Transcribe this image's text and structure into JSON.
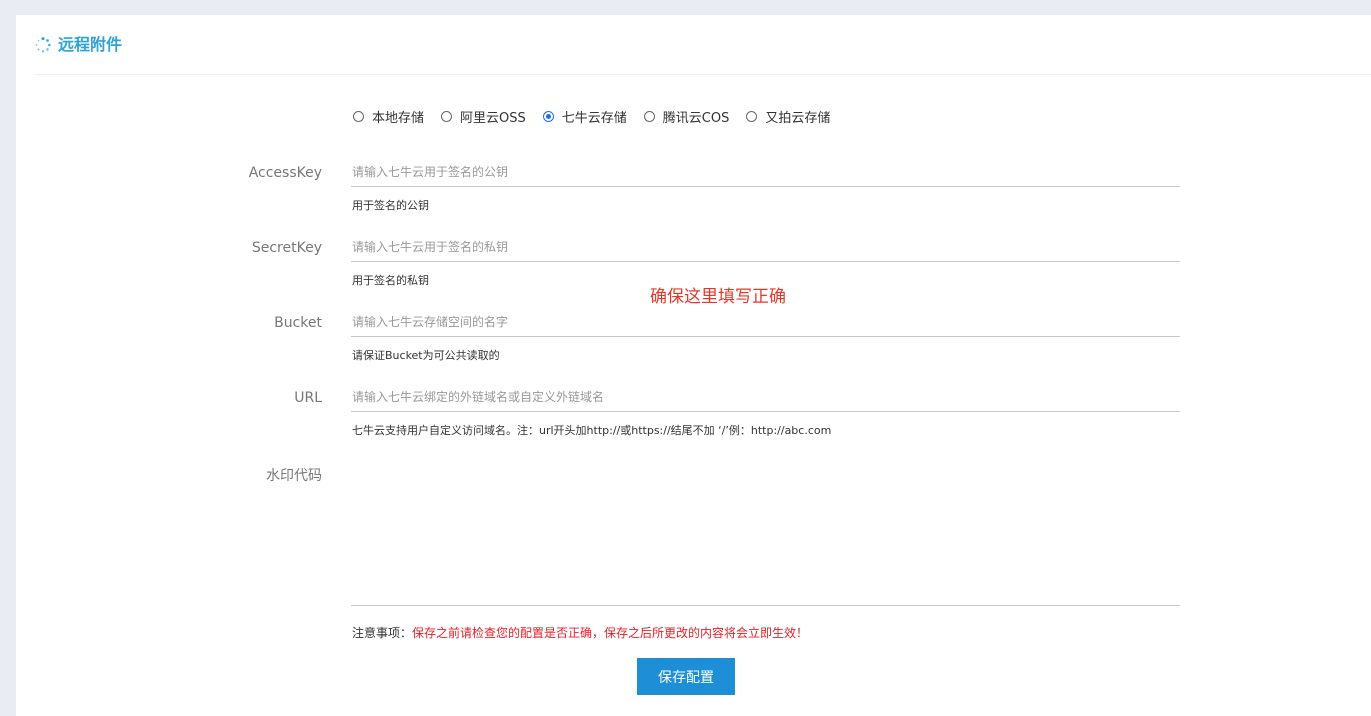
{
  "panel": {
    "title": "远程附件",
    "title_icon": "loading-spinner-icon",
    "accent_color": "#2fa4d4"
  },
  "storage_options": {
    "selected": "七牛云存储",
    "items": [
      {
        "label": "本地存储",
        "checked": false
      },
      {
        "label": "阿里云OSS",
        "checked": false
      },
      {
        "label": "七牛云存储",
        "checked": true
      },
      {
        "label": "腾讯云COS",
        "checked": false
      },
      {
        "label": "又拍云存储",
        "checked": false
      }
    ]
  },
  "fields": {
    "access_key": {
      "label": "AccessKey",
      "placeholder": "请输入七牛云用于签名的公钥",
      "value": "",
      "help": "用于签名的公钥"
    },
    "secret_key": {
      "label": "SecretKey",
      "placeholder": "请输入七牛云用于签名的私钥",
      "value": "",
      "help": "用于签名的私钥"
    },
    "bucket": {
      "label": "Bucket",
      "placeholder": "请输入七牛云存储空间的名字",
      "value": "",
      "help": "请保证Bucket为可公共读取的"
    },
    "url": {
      "label": "URL",
      "placeholder": "请输入七牛云绑定的外链域名或自定义外链域名",
      "value": "",
      "help": "七牛云支持用户自定义访问域名。注：url开头加http://或https://结尾不加 ‘/’例：http://abc.com"
    },
    "watermark": {
      "label": "水印代码",
      "value": ""
    }
  },
  "annotation": {
    "text": "确保这里填写正确",
    "color": "#e8372a"
  },
  "notice": {
    "label": "注意事项：",
    "text": "保存之前请检查您的配置是否正确，保存之后所更改的内容将会立即生效！",
    "color": "#e8202a"
  },
  "actions": {
    "save_label": "保存配置",
    "save_color": "#1e8fd6"
  }
}
